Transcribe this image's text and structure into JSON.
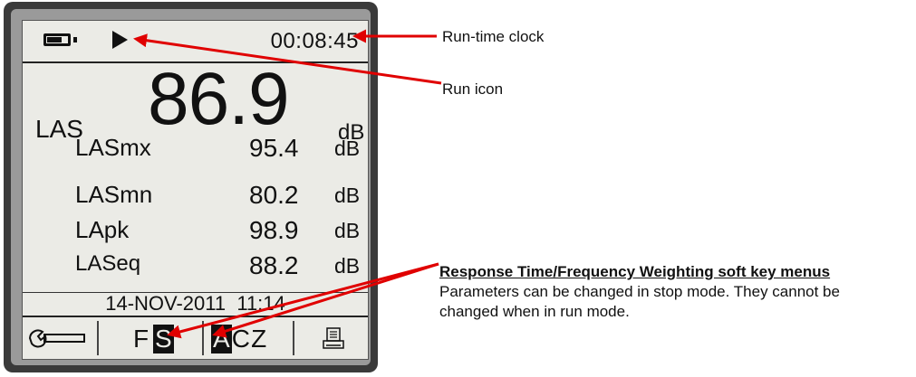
{
  "device": {
    "clock": "00:08:45",
    "main": {
      "label": "LAS",
      "value": "86.9",
      "unit": "dB"
    },
    "rows": [
      {
        "label": "LASmx",
        "value": "95.4",
        "unit": "dB"
      },
      {
        "label": "LASmn",
        "value": "80.2",
        "unit": "dB"
      },
      {
        "label": "LApk",
        "value": "98.9",
        "unit": "dB"
      },
      {
        "label": "LASeq",
        "value": "88.2",
        "unit": "dB"
      }
    ],
    "datetime": "14-NOV-2011  11:14",
    "softkeys": {
      "response_time": {
        "f": "F",
        "s": "S"
      },
      "frequency_weighting": {
        "a": "A",
        "c": "C",
        "z": "Z"
      }
    },
    "icons": [
      "battery-icon",
      "run-icon",
      "wrench-icon",
      "printer-icon"
    ]
  },
  "annotations": {
    "run_time_clock": "Run-time clock",
    "run_icon": "Run icon",
    "softkey_title": "Response Time/Frequency Weighting soft key menus",
    "softkey_line1": "Parameters can be changed in stop mode. They cannot be",
    "softkey_line2": "changed when in run mode."
  },
  "colors": {
    "arrow": "#e00000",
    "screen": "#ebebe6",
    "bezel": "#3a3a3a"
  }
}
